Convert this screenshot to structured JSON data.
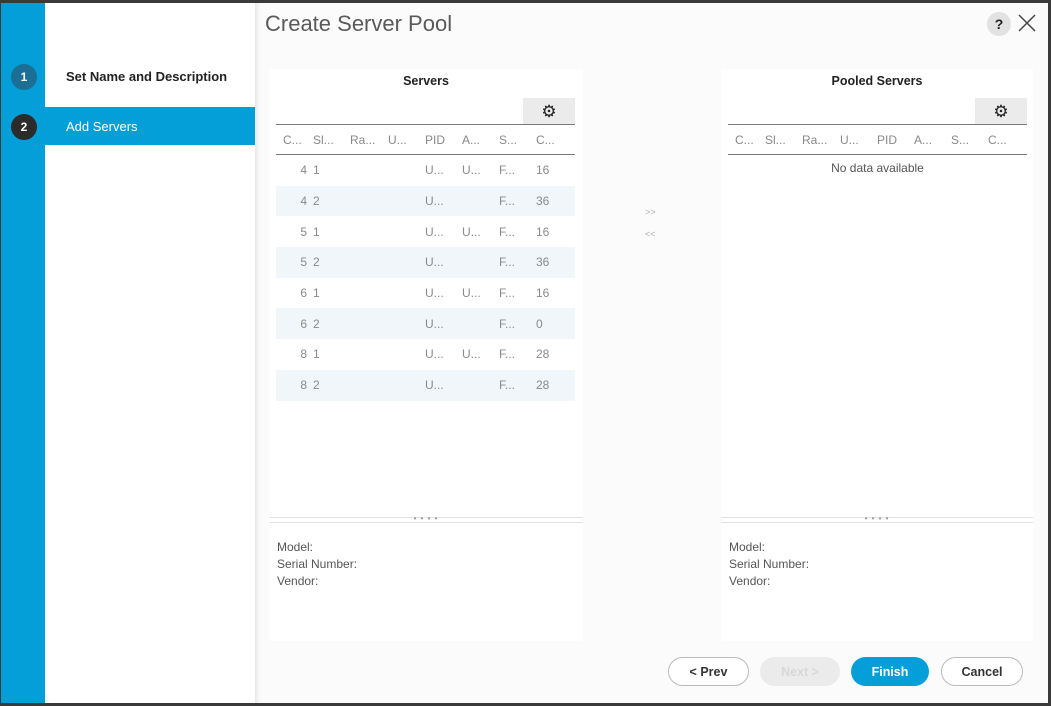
{
  "dialog": {
    "title": "Create Server Pool",
    "help_label": "?",
    "close_label": "close"
  },
  "wizard": {
    "steps": [
      {
        "number": "1",
        "label": "Set Name and Description",
        "active": false
      },
      {
        "number": "2",
        "label": "Add Servers",
        "active": true
      }
    ]
  },
  "colors": {
    "accent": "#049fd9",
    "step_done": "#1b6f94",
    "step_current": "#2b2b2b"
  },
  "servers": {
    "title": "Servers",
    "columns": [
      "C...",
      "Sl...",
      "Ra...",
      "U...",
      "PID",
      "A...",
      "S...",
      "C..."
    ],
    "rows": [
      [
        "4",
        "1",
        "",
        "",
        "U...",
        "U...",
        "F...",
        "16"
      ],
      [
        "4",
        "2",
        "",
        "",
        "U...",
        "",
        "F...",
        "36"
      ],
      [
        "5",
        "1",
        "",
        "",
        "U...",
        "U...",
        "F...",
        "16"
      ],
      [
        "5",
        "2",
        "",
        "",
        "U...",
        "",
        "F...",
        "36"
      ],
      [
        "6",
        "1",
        "",
        "",
        "U...",
        "U...",
        "F...",
        "16"
      ],
      [
        "6",
        "2",
        "",
        "",
        "U...",
        "",
        "F...",
        "0"
      ],
      [
        "8",
        "1",
        "",
        "",
        "U...",
        "U...",
        "F...",
        "28"
      ],
      [
        "8",
        "2",
        "",
        "",
        "U...",
        "",
        "F...",
        "28"
      ]
    ],
    "details": {
      "model": "Model:",
      "serial": "Serial Number:",
      "vendor": "Vendor:"
    }
  },
  "pooled": {
    "title": "Pooled Servers",
    "columns": [
      "C...",
      "Sl...",
      "Ra...",
      "U...",
      "PID",
      "A...",
      "S...",
      "C..."
    ],
    "empty_text": "No data available",
    "details": {
      "model": "Model:",
      "serial": "Serial Number:",
      "vendor": "Vendor:"
    }
  },
  "movers": {
    "add": ">>",
    "remove": "<<"
  },
  "splitter_dots": "• • • •",
  "footer": {
    "prev": "< Prev",
    "next": "Next >",
    "finish": "Finish",
    "cancel": "Cancel"
  }
}
